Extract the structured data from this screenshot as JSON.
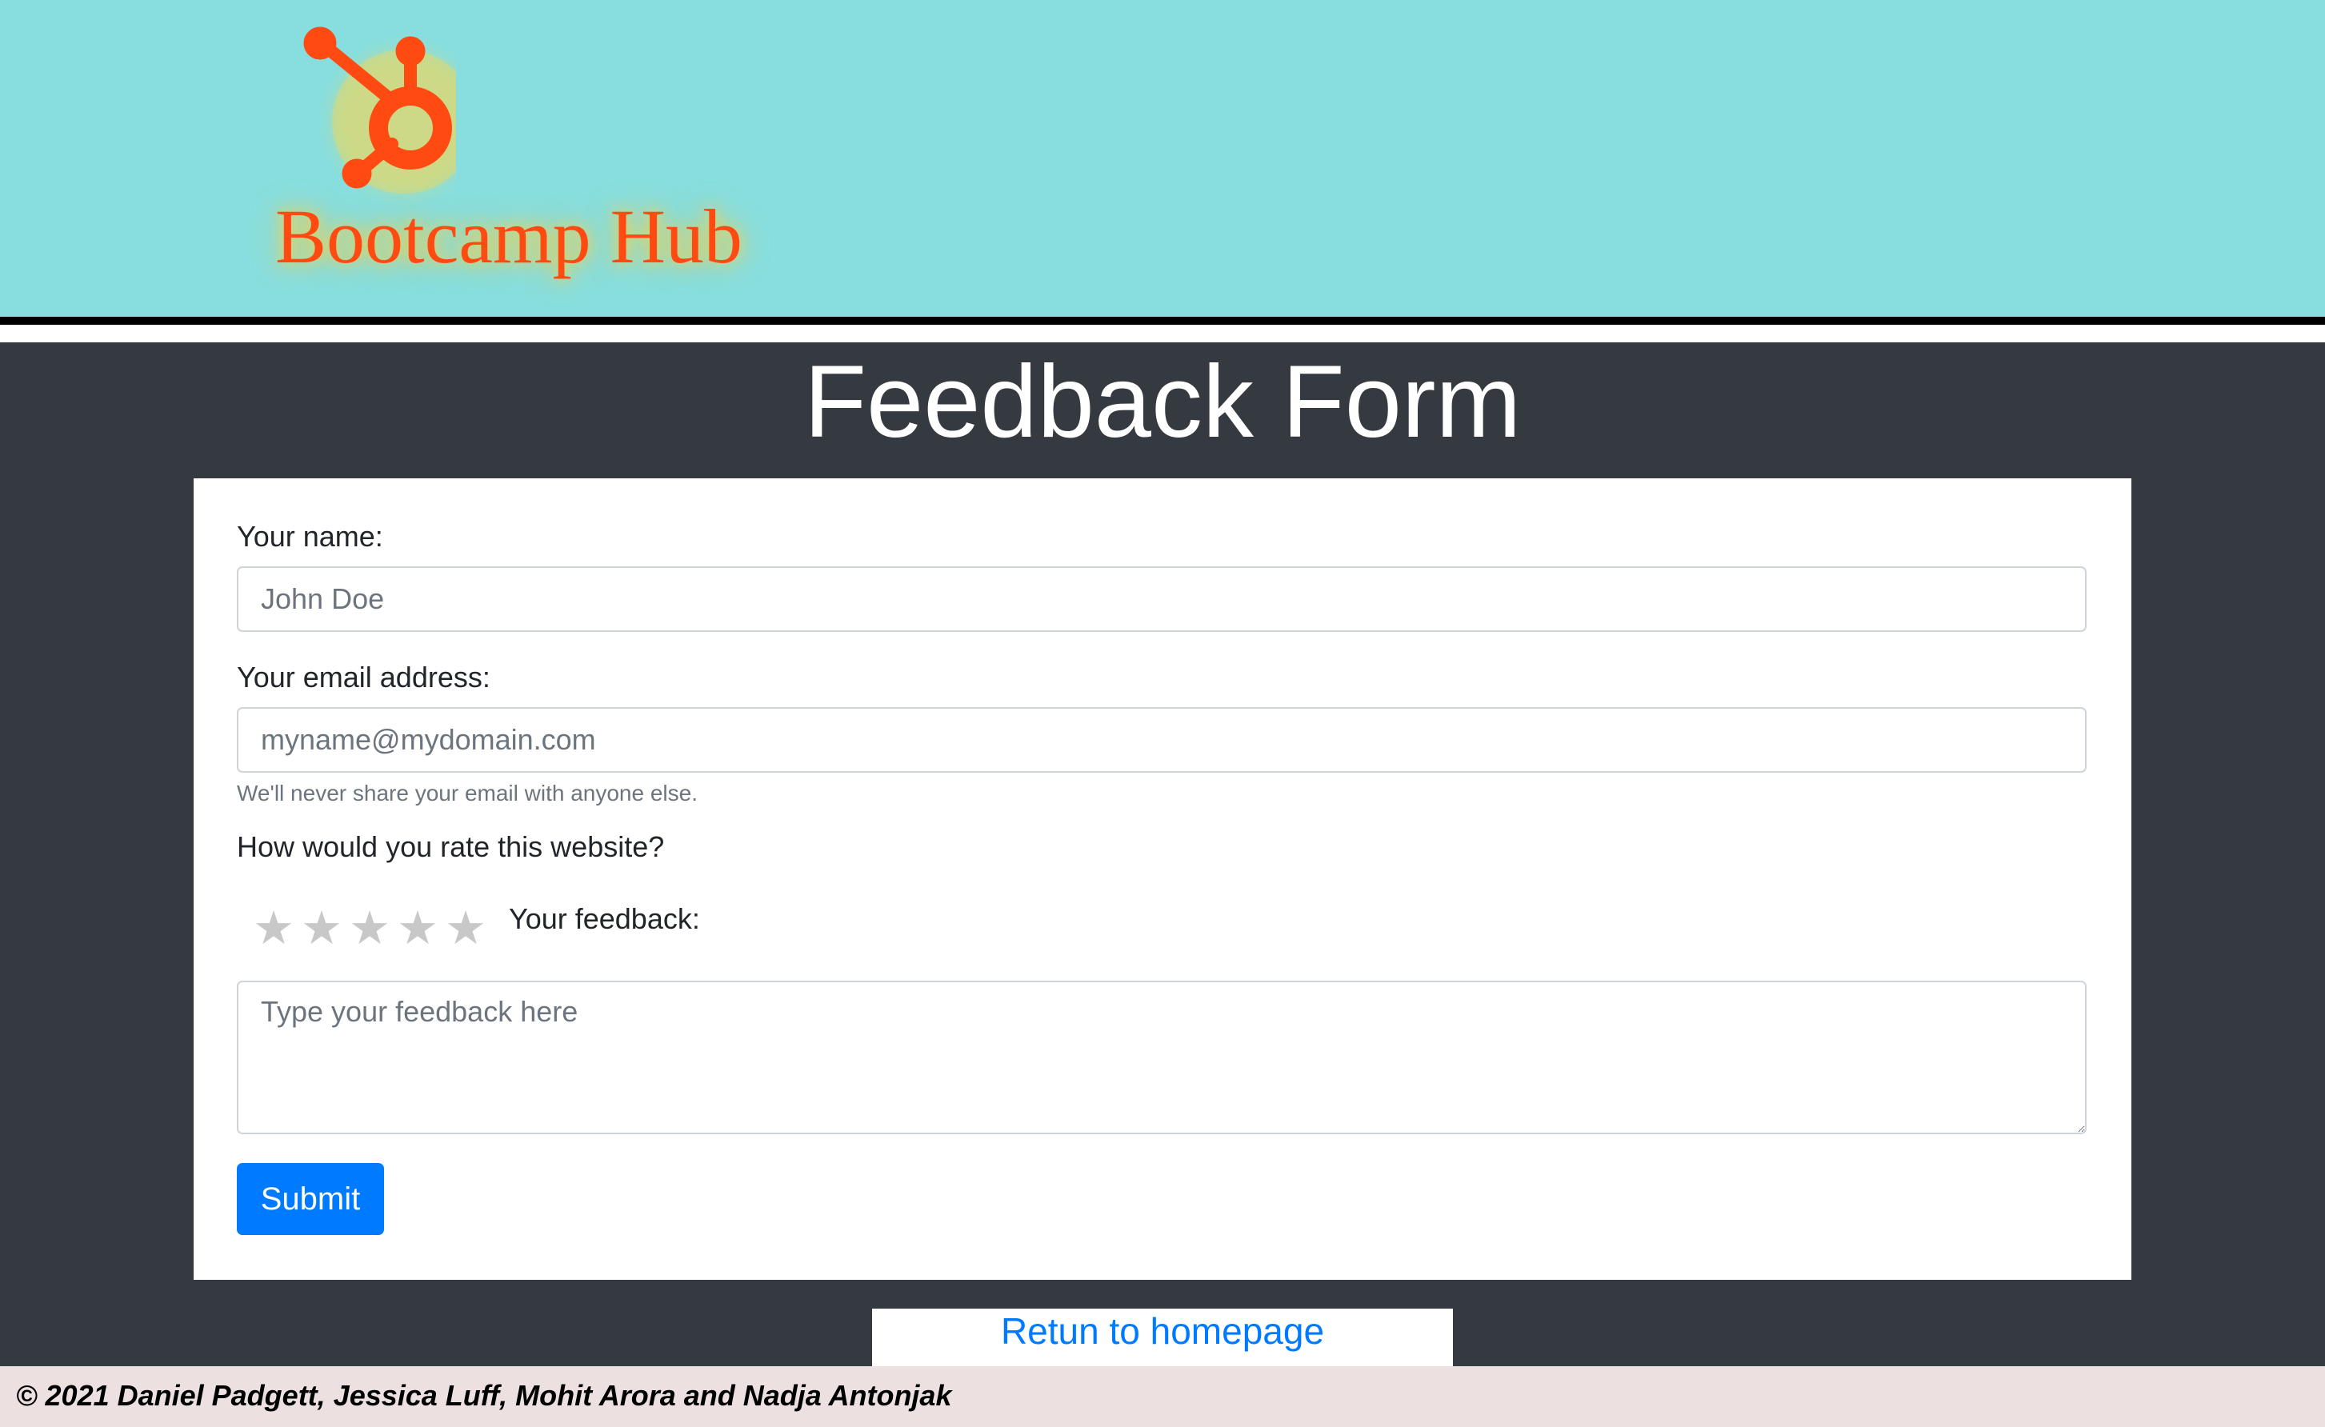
{
  "header": {
    "brand_name": "Bootcamp Hub",
    "logo_icon": "hubspot-sprocket-icon",
    "background_color": "#88dede",
    "brand_color": "#ff4a12"
  },
  "main": {
    "title": "Feedback Form",
    "background_color": "#343a40"
  },
  "form": {
    "name_label": "Your name:",
    "name_placeholder": "John Doe",
    "name_value": "",
    "email_label": "Your email address:",
    "email_placeholder": "myname@mydomain.com",
    "email_value": "",
    "email_help": "We'll never share your email with anyone else.",
    "rating_question": "How would you rate this website?",
    "rating": {
      "max": 5,
      "selected": 0,
      "star_glyph": "★",
      "star_color": "#c8c8c8",
      "icon": "star-icon"
    },
    "feedback_label": "Your feedback:",
    "feedback_placeholder": "Type your feedback here",
    "feedback_value": "",
    "submit_label": "Submit",
    "submit_color": "#007bff"
  },
  "return_link": {
    "label": "Retun to homepage",
    "color": "#007bff"
  },
  "footer": {
    "text": "© 2021 Daniel Padgett, Jessica Luff, Mohit Arora and Nadja Antonjak",
    "background_color": "#ece0e0"
  }
}
